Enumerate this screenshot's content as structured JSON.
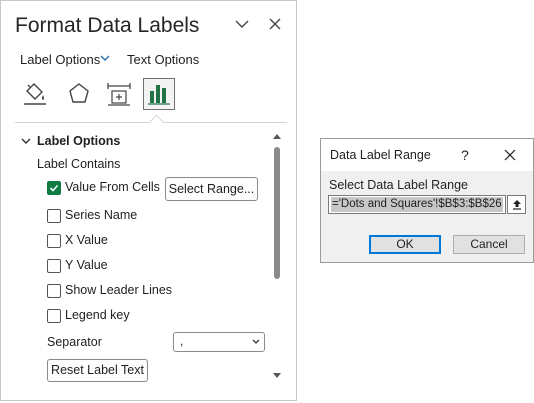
{
  "pane": {
    "title": "Format Data Labels",
    "tabs": [
      {
        "label": "Label Options"
      },
      {
        "label": "Text Options"
      }
    ],
    "icons": [
      {
        "name": "fill-line-icon"
      },
      {
        "name": "effects-icon"
      },
      {
        "name": "size-properties-icon"
      },
      {
        "name": "label-options-icon",
        "selected": true
      }
    ],
    "section": {
      "title": "Label Options",
      "contains_label": "Label Contains",
      "options": [
        {
          "label": "Value From Cells",
          "checked": true
        },
        {
          "label": "Series Name",
          "checked": false
        },
        {
          "label": "X Value",
          "checked": false
        },
        {
          "label": "Y Value",
          "checked": false
        },
        {
          "label": "Show Leader Lines",
          "checked": false
        },
        {
          "label": "Legend key",
          "checked": false
        }
      ],
      "select_range_button": "Select Range...",
      "separator_label": "Separator",
      "separator_value": ",",
      "reset_button": "Reset Label Text"
    }
  },
  "dialog": {
    "title": "Data Label Range",
    "help": "?",
    "field_label": "Select Data Label Range",
    "field_value": "='Dots and Squares'!$B$3:$B$26",
    "ok": "OK",
    "cancel": "Cancel"
  },
  "colors": {
    "accent_green": "#107c41",
    "chart_icon_green": "#217346",
    "ok_focus_blue": "#0078d7"
  }
}
